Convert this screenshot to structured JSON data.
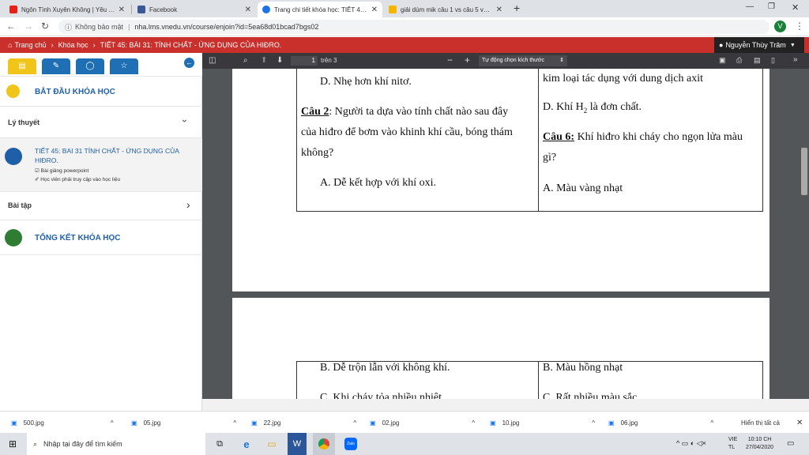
{
  "browser": {
    "tabs": [
      {
        "title": "Ngôn Tình Xuyên Không | Yêu Đi...",
        "favicon_color": "#e62117"
      },
      {
        "title": "Facebook",
        "favicon_color": "#3b5998"
      },
      {
        "title": "Trang chi tiết khóa học: TIẾT 45: ...",
        "favicon_color": "#1a73e8"
      },
      {
        "title": "giải dùm mik câu 1 vs câu 5 vs câ...",
        "favicon_color": "#f4b400"
      }
    ],
    "new_tab": "+",
    "security_label": "Không bảo mật",
    "url": "nha.lms.vnedu.vn/course/enjoin?id=5ea68d01bcad7bgs02",
    "profile_initial": "V"
  },
  "header": {
    "breadcrumbs": [
      "Trang chủ",
      "Khóa học",
      "TIẾT 45: BÀI 31: TÍNH CHẤT - ỨNG DỤNG CỦA HIĐRO."
    ],
    "user": "Nguyễn Thùy Trâm",
    "accent_color": "#c9302c"
  },
  "sidebar": {
    "start": "BẮT ĐẦU KHÓA HỌC",
    "theory": "Lý thuyết",
    "lesson_title": "TIẾT 45: BAI 31 TÍNH CHẤT - ỨNG DỤNG CỦA HIĐRO.",
    "lesson_sub1": "Bài giảng powerpoint",
    "lesson_sub2": "Học viên phải truy cập vào học liệu",
    "exercises": "Bài tập",
    "summary": "TỔNG KẾT KHÓA HỌC"
  },
  "pdf": {
    "page_number": "1",
    "page_total": "trên 3",
    "zoom": "Tự động chọn kích thước",
    "page1": {
      "left": {
        "d_answer": "D. Nhẹ hơn khí nitơ.",
        "q2_label": "Câu 2",
        "q2_line1": ": Người ta dựa vào tính chất nào sau đây",
        "q2_line2": "của hiđro để bơm vào khinh khí cầu, bóng thám",
        "q2_line3": "không?",
        "q2_a": "A. Dễ kết hợp với khí oxi."
      },
      "right": {
        "line1": "kim loại tác dụng với dung dịch axit",
        "d_pre": "D. Khí H",
        "d_sub": "2",
        "d_post": " là đơn chất.",
        "q6_label": "Câu 6:",
        "q6_line1": " Khí hiđro khi cháy cho ngọn lửa màu",
        "q6_line2": "gì?",
        "q6_a": "A. Màu vàng nhạt"
      }
    },
    "page2": {
      "left_b": "B. Dễ trộn lẫn với không khí.",
      "left_c": "C. Khi cháy tỏa nhiều nhiệt",
      "right_b": "B. Màu hồng nhạt",
      "right_c": "C. Rất nhiều màu sắc"
    }
  },
  "downloads": {
    "files": [
      "500.jpg",
      "05.jpg",
      "22.jpg",
      "02.jpg",
      "10.jpg",
      "06.jpg"
    ],
    "show_all": "Hiển thị tất cả"
  },
  "taskbar": {
    "search_placeholder": "Nhập tại đây để tìm kiếm",
    "lang1": "VIE",
    "lang2": "TL",
    "time": "10:10 CH",
    "date": "27/04/2020"
  }
}
